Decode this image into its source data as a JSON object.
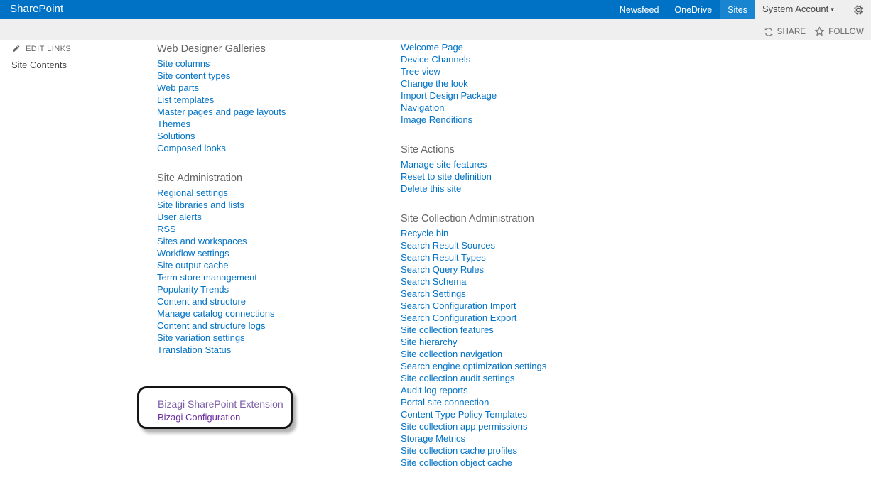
{
  "suitebar": {
    "brand": "SharePoint",
    "links": [
      {
        "label": "Newsfeed",
        "selected": false
      },
      {
        "label": "OneDrive",
        "selected": false
      },
      {
        "label": "Sites",
        "selected": true
      }
    ],
    "account": "System Account",
    "caret": "▾",
    "gear_icon": "gear-icon",
    "brand_color": "#0072c6",
    "selected_tab_color": "#1985d0"
  },
  "actionbar": {
    "share_label": "SHARE",
    "follow_label": "FOLLOW",
    "share_icon": "share-icon",
    "follow_icon": "star-icon"
  },
  "quicklaunch": {
    "edit_links_label": "EDIT LINKS",
    "edit_links_icon": "pencil-icon",
    "items": [
      {
        "label": "Site Contents"
      }
    ]
  },
  "settings": {
    "link_color": "#0072c6",
    "heading_color": "#666666",
    "left_column": [
      {
        "title": "Web Designer Galleries",
        "links": [
          "Site columns",
          "Site content types",
          "Web parts",
          "List templates",
          "Master pages and page layouts",
          "Themes",
          "Solutions",
          "Composed looks"
        ]
      },
      {
        "title": "Site Administration",
        "links": [
          "Regional settings",
          "Site libraries and lists",
          "User alerts",
          "RSS",
          "Sites and workspaces",
          "Workflow settings",
          "Site output cache",
          "Term store management",
          "Popularity Trends",
          "Content and structure",
          "Manage catalog connections",
          "Content and structure logs",
          "Site variation settings",
          "Translation Status"
        ]
      }
    ],
    "right_column": [
      {
        "title": "",
        "links": [
          "Welcome Page",
          "Device Channels",
          "Tree view",
          "Change the look",
          "Import Design Package",
          "Navigation",
          "Image Renditions"
        ]
      },
      {
        "title": "Site Actions",
        "links": [
          "Manage site features",
          "Reset to site definition",
          "Delete this site"
        ]
      },
      {
        "title": "Site Collection Administration",
        "links": [
          "Recycle bin",
          "Search Result Sources",
          "Search Result Types",
          "Search Query Rules",
          "Search Schema",
          "Search Settings",
          "Search Configuration Import",
          "Search Configuration Export",
          "Site collection features",
          "Site hierarchy",
          "Site collection navigation",
          "Search engine optimization settings",
          "Site collection audit settings",
          "Audit log reports",
          "Portal site connection",
          "Content Type Policy Templates",
          "Site collection app permissions",
          "Storage Metrics",
          "Site collection cache profiles",
          "Site collection object cache"
        ]
      }
    ]
  },
  "callout": {
    "title": "Bizagi SharePoint Extension",
    "link": "Bizagi Configuration",
    "visited_link_color": "#6b2fa0",
    "border_color": "#141414"
  }
}
